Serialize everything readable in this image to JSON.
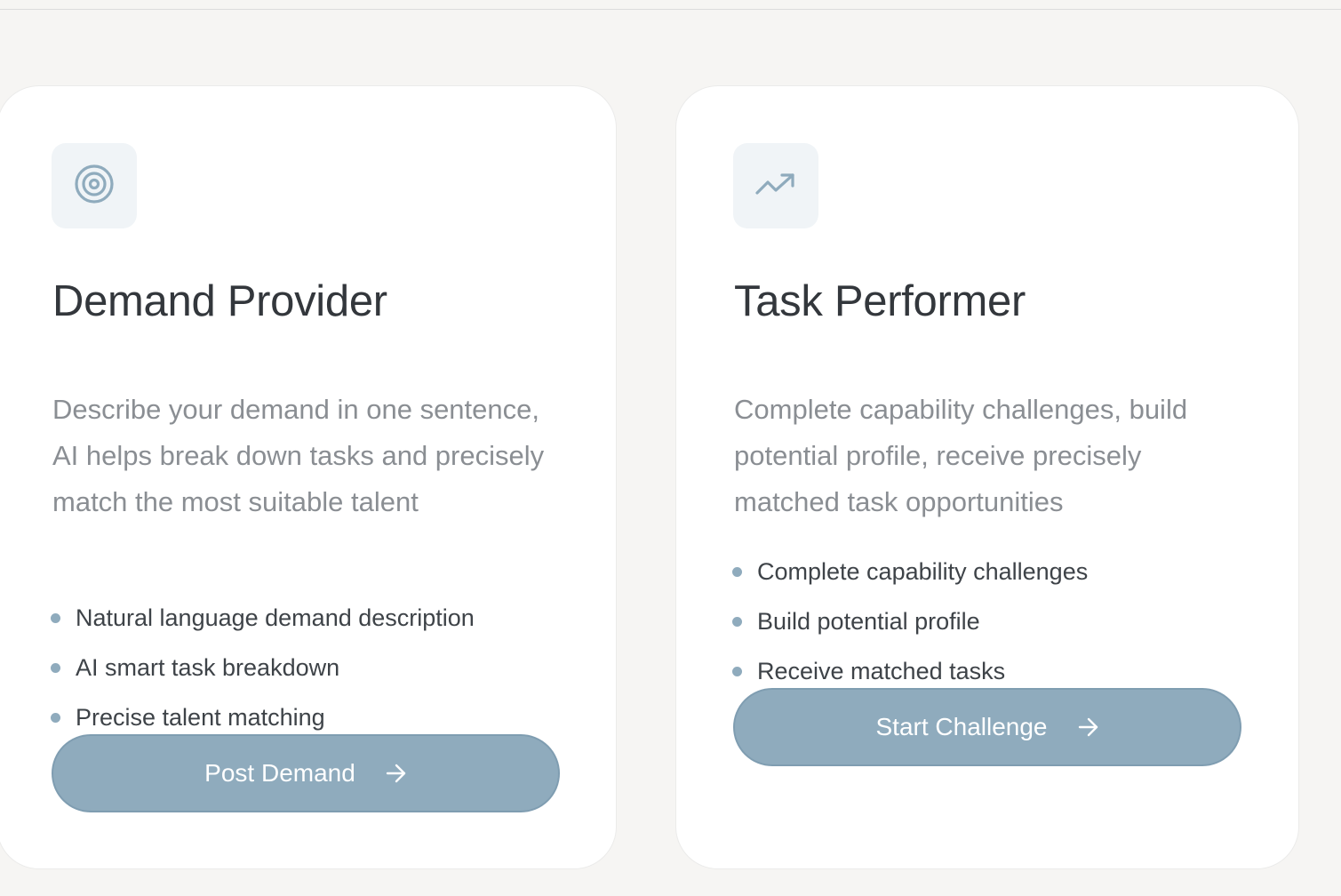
{
  "colors": {
    "page_background": "#f6f5f3",
    "card_background": "#ffffff",
    "accent": "#8fabbd",
    "title_text": "#33373c",
    "description_text": "#8a8e93",
    "icon_tile": "#f0f4f7"
  },
  "cards": [
    {
      "icon": "target-icon",
      "title": "Demand Provider",
      "description": "Describe your demand in one sentence, AI helps break down tasks and precisely match the most suitable talent",
      "features": [
        "Natural language demand description",
        "AI smart task breakdown",
        "Precise talent matching"
      ],
      "button_label": "Post Demand",
      "button_icon": "arrow-right-icon"
    },
    {
      "icon": "trending-up-icon",
      "title": "Task Performer",
      "description": "Complete capability challenges, build potential profile, receive precisely matched task opportunities",
      "features": [
        "Complete capability challenges",
        "Build potential profile",
        "Receive matched tasks"
      ],
      "button_label": "Start Challenge",
      "button_icon": "arrow-right-icon"
    }
  ]
}
